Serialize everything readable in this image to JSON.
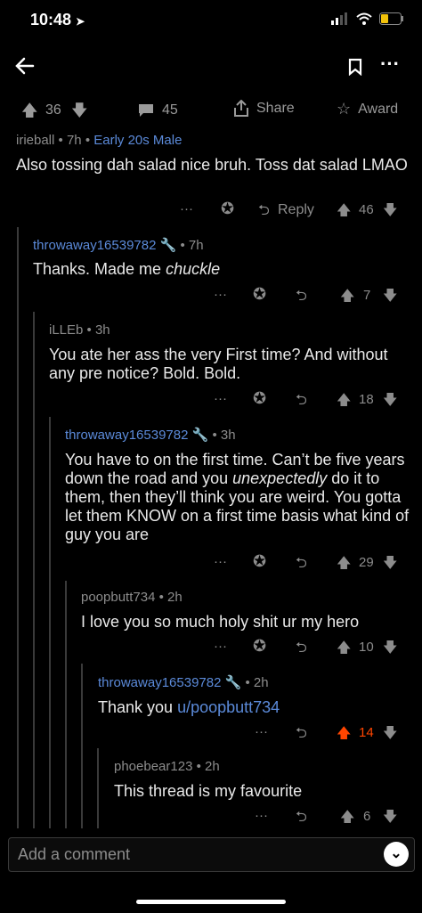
{
  "status": {
    "time": "10:48"
  },
  "action_bar": {
    "upvotes": "36",
    "comments": "45",
    "share": "Share",
    "award": "Award"
  },
  "comments": [
    {
      "user": "irieball",
      "age": "7h",
      "flair": "Early 20s Male",
      "text": "Also tossing dah salad nice bruh. Toss dat salad LMAO",
      "reply": "Reply",
      "score": "46"
    },
    {
      "user": "throwaway16539782",
      "age": "7h",
      "text_plain": "Thanks. Made me ",
      "text_italic": "chuckle",
      "score": "7"
    },
    {
      "user": "iLLEb",
      "age": "3h",
      "text": "You ate her ass the very First time? And without any pre notice? Bold. Bold.",
      "score": "18"
    },
    {
      "user": "throwaway16539782",
      "age": "3h",
      "text_a": "You have to on the first time. Can’t be five years down the road and you ",
      "text_italic": "unexpectedly",
      "text_b": " do it to them, then they’ll think you are weird. You gotta let them KNOW on a first time basis what kind of guy you are",
      "score": "29"
    },
    {
      "user": "poopbutt734",
      "age": "2h",
      "text": "I love you so much holy shit ur my hero",
      "score": "10"
    },
    {
      "user": "throwaway16539782",
      "age": "2h",
      "text_plain": "Thank you ",
      "text_link": "u/poopbutt734",
      "score": "14"
    },
    {
      "user": "phoebear123",
      "age": "2h",
      "text": "This thread is my favourite",
      "score": "6"
    }
  ],
  "composer": {
    "placeholder": "Add a comment"
  },
  "colors": {
    "accent_blue": "#5b8ad9",
    "upvoted_orange": "#ff4500"
  }
}
